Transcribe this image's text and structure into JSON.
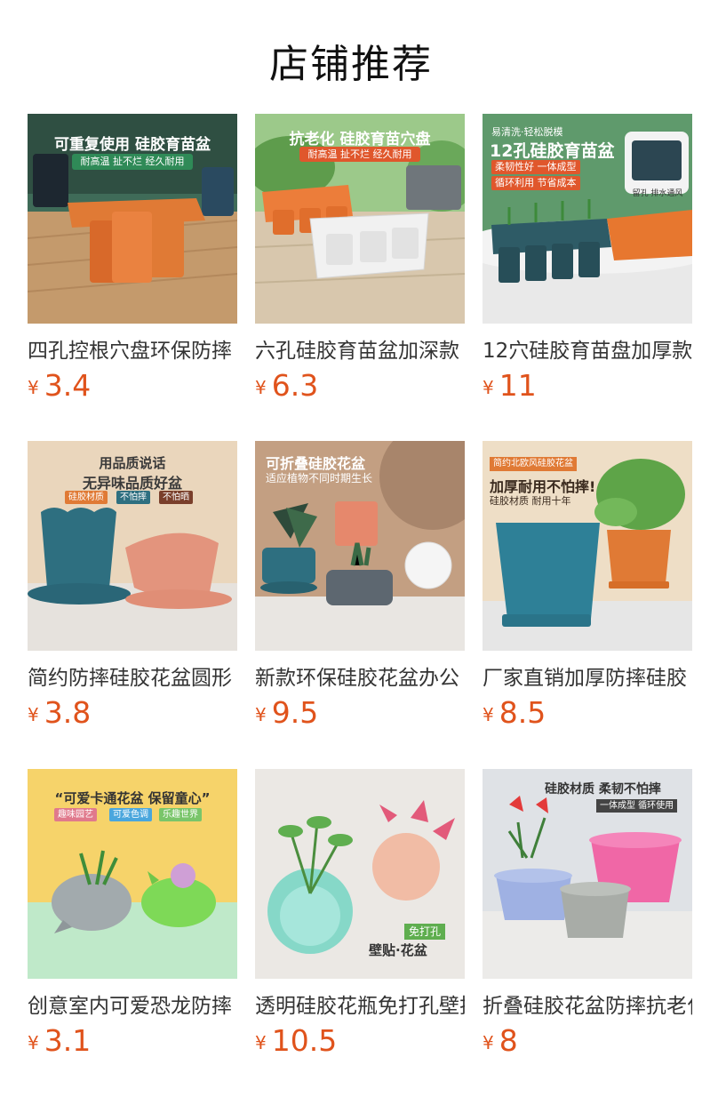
{
  "header": {
    "title": "店铺推荐"
  },
  "currency_symbol": "¥",
  "products": [
    {
      "name": "四孔控根穴盘环保防摔",
      "price": "3.4",
      "image_text": [
        "可重复使用 硅胶育苗盆",
        "耐高温 扯不烂 经久耐用"
      ],
      "colors": {
        "bg": "#c9a67e",
        "accent": "#e07a35",
        "band": "#2f5d4e"
      }
    },
    {
      "name": "六孔硅胶育苗盆加深款",
      "price": "6.3",
      "image_text": [
        "抗老化 硅胶育苗穴盘",
        "耐高温 扯不烂 经久耐用"
      ],
      "colors": {
        "bg": "#8cc07a",
        "accent": "#e07a35",
        "band": "#6a6f73"
      }
    },
    {
      "name": "12穴硅胶育苗盘加厚款",
      "price": "11",
      "image_text": [
        "易清洗·轻松脱模",
        "12孔硅胶育苗盆",
        "柔韧性好 一体成型",
        "循环利用 节省成本",
        "留孔 排水通风"
      ],
      "colors": {
        "bg": "#6aa377",
        "accent": "#e07a35",
        "band": "#2f5a66"
      }
    },
    {
      "name": "简约防摔硅胶花盆圆形",
      "price": "3.8",
      "image_text": [
        "用品质说话",
        "无异味品质好盆",
        "硅胶材质",
        "不怕摔",
        "不怕晒"
      ],
      "colors": {
        "bg": "#e8d2b6",
        "accent": "#2e6f80",
        "band": "#e39982"
      }
    },
    {
      "name": "新款环保硅胶花盆办公",
      "price": "9.5",
      "image_text": [
        "可折叠硅胶花盆",
        "适应植物不同时期生长"
      ],
      "colors": {
        "bg": "#c6a487",
        "accent": "#2e6f80",
        "band": "#e6886c"
      }
    },
    {
      "name": "厂家直销加厚防摔硅胶",
      "price": "8.5",
      "image_text": [
        "简约北欧风硅胶花盆",
        "加厚耐用不怕摔!",
        "硅胶材质 耐用十年"
      ],
      "colors": {
        "bg": "#ead9c0",
        "accent": "#2e7f93",
        "band": "#e07a35"
      }
    },
    {
      "name": "创意室内可爱恐龙防摔",
      "price": "3.1",
      "image_text": [
        "“可爱卡通花盆 保留童心”",
        "趣味园艺",
        "可爱色调",
        "乐趣世界"
      ],
      "colors": {
        "bg": "#f6d36a",
        "accent": "#9aa3a6",
        "band": "#7ed957"
      }
    },
    {
      "name": "透明硅胶花瓶免打孔壁挂",
      "price": "10.5",
      "image_text": [
        "免打孔",
        "壁贴·花盆"
      ],
      "colors": {
        "bg": "#e7e3de",
        "accent": "#7bd3c4",
        "band": "#f0b7a0"
      }
    },
    {
      "name": "折叠硅胶花盆防摔抗老化",
      "price": "8",
      "image_text": [
        "硅胶材质 柔韧不怕摔",
        "一体成型 循环使用"
      ],
      "colors": {
        "bg": "#d9dde1",
        "accent": "#f067a6",
        "band": "#8fa0d6"
      }
    }
  ]
}
